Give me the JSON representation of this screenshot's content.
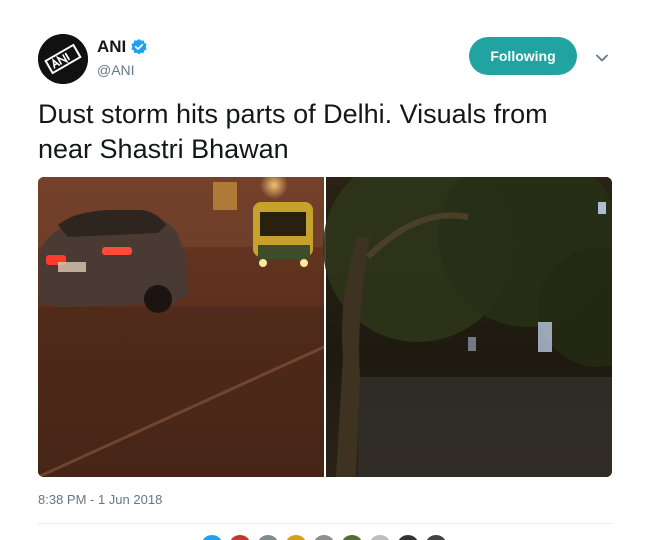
{
  "account": {
    "display_name": "ANI",
    "handle": "@ANI",
    "avatar_text": "ANI",
    "verified": true
  },
  "follow_button": {
    "label": "Following"
  },
  "tweet": {
    "text": "Dust storm hits parts of Delhi. Visuals from near Shastri Bhawan",
    "timestamp": "8:38 PM - 1 Jun 2018"
  },
  "icons": {
    "verified": "verified-badge-icon",
    "caret": "chevron-down-icon"
  },
  "colors": {
    "follow_button": "#21a3a1",
    "verified_badge": "#1da1f2",
    "handle_text": "#657786"
  },
  "likers": [
    {
      "color": "#1da1f2"
    },
    {
      "color": "#c0392b"
    },
    {
      "color": "#7f8c8d"
    },
    {
      "color": "#d4a017"
    },
    {
      "color": "#8e8e8e"
    },
    {
      "color": "#556b2f"
    },
    {
      "color": "#bdbdbd"
    },
    {
      "color": "#333333"
    },
    {
      "color": "#444444"
    }
  ]
}
